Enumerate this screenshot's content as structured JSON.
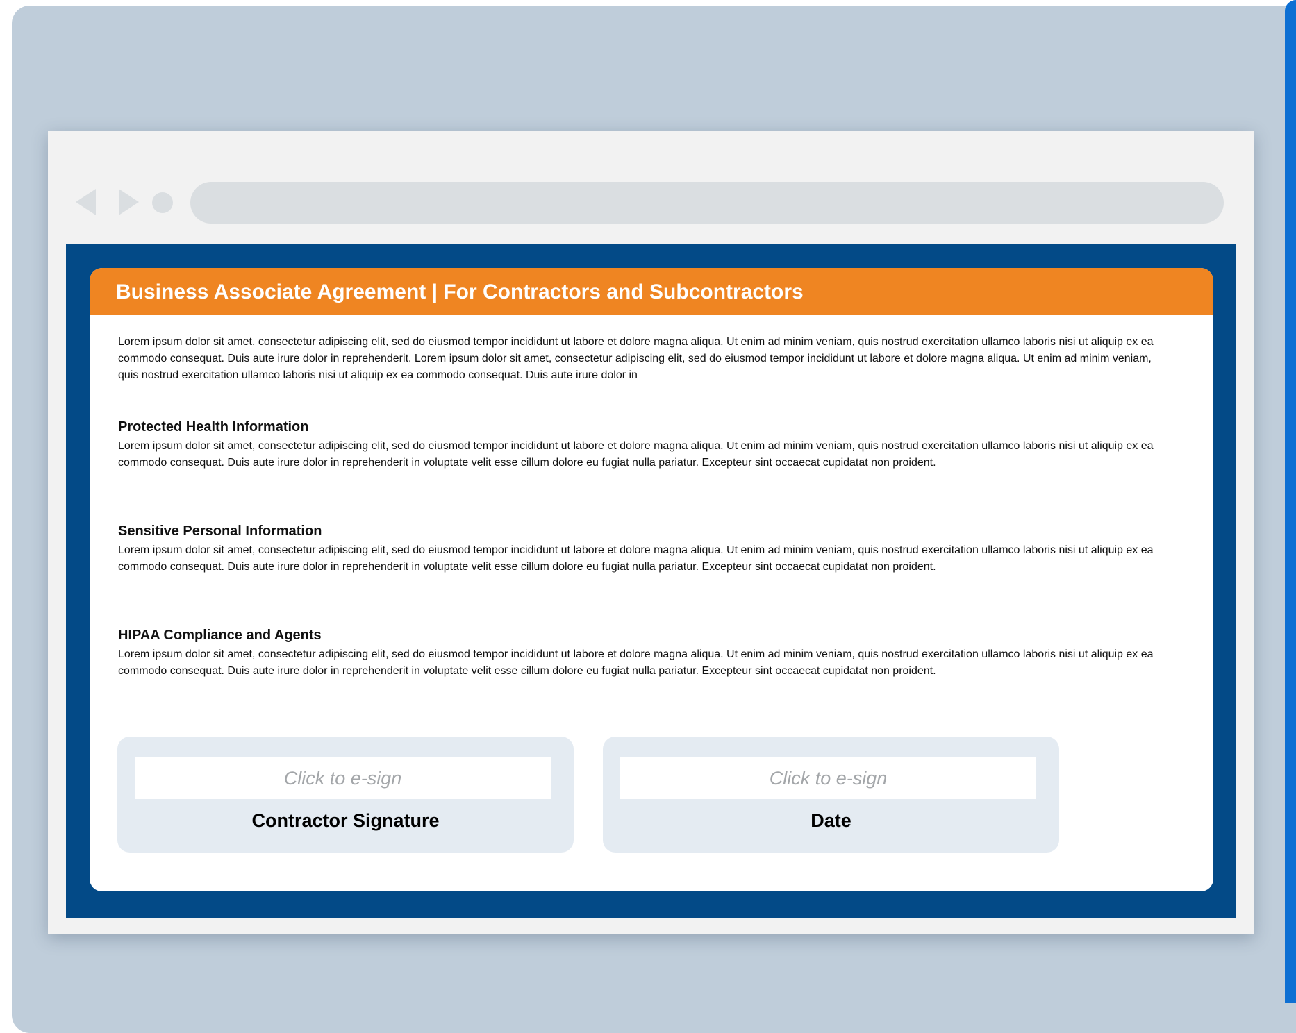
{
  "browser": {
    "back_icon": "chevron-left-icon",
    "forward_icon": "chevron-right-icon",
    "reload_icon": "dot-icon",
    "address_bar": ""
  },
  "document": {
    "title": "Business Associate Agreement | For Contractors and Subcontractors",
    "intro": "Lorem ipsum dolor sit amet, consectetur adipiscing elit, sed do eiusmod tempor incididunt ut labore et dolore magna aliqua. Ut enim ad minim veniam, quis nostrud exercitation ullamco laboris nisi ut aliquip ex ea commodo consequat. Duis aute irure dolor in reprehenderit. Lorem ipsum dolor sit amet, consectetur adipiscing elit, sed do eiusmod tempor incididunt ut labore et dolore magna aliqua. Ut enim ad minim veniam, quis nostrud exercitation ullamco laboris nisi ut aliquip ex ea commodo consequat. Duis aute irure dolor in",
    "sections": [
      {
        "heading": "Protected Health Information",
        "body": "Lorem ipsum dolor sit amet, consectetur adipiscing elit, sed do eiusmod tempor incididunt ut labore et dolore magna aliqua. Ut enim ad minim veniam, quis nostrud exercitation ullamco laboris nisi ut aliquip ex ea commodo consequat.  Duis aute irure dolor in reprehenderit in voluptate velit esse cillum dolore eu fugiat nulla pariatur. Excepteur sint occaecat cupidatat non proident."
      },
      {
        "heading": "Sensitive Personal Information",
        "body": "Lorem ipsum dolor sit amet, consectetur adipiscing elit, sed do eiusmod tempor incididunt ut labore et dolore magna aliqua. Ut enim ad minim veniam, quis nostrud exercitation ullamco laboris nisi ut aliquip ex ea commodo consequat.  Duis aute irure dolor in reprehenderit in voluptate velit esse cillum dolore eu fugiat nulla pariatur. Excepteur sint occaecat cupidatat non proident."
      },
      {
        "heading": "HIPAA Compliance and Agents",
        "body": "Lorem ipsum dolor sit amet, consectetur adipiscing elit, sed do eiusmod tempor incididunt ut labore et dolore magna aliqua. Ut enim ad minim veniam, quis nostrud exercitation ullamco laboris nisi ut aliquip ex ea commodo consequat.  Duis aute irure dolor in reprehenderit in voluptate velit esse cillum dolore eu fugiat nulla pariatur. Excepteur sint occaecat cupidatat non proident."
      }
    ]
  },
  "signatures": [
    {
      "placeholder": "Click to e-sign",
      "label": "Contractor Signature"
    },
    {
      "placeholder": "Click to e-sign",
      "label": "Date"
    }
  ],
  "colors": {
    "page_background": "#bfcdda",
    "accent_strip": "#0d6fd3",
    "frame": "#034a87",
    "header": "#ef8522",
    "signature_box": "#e4ebf2"
  }
}
